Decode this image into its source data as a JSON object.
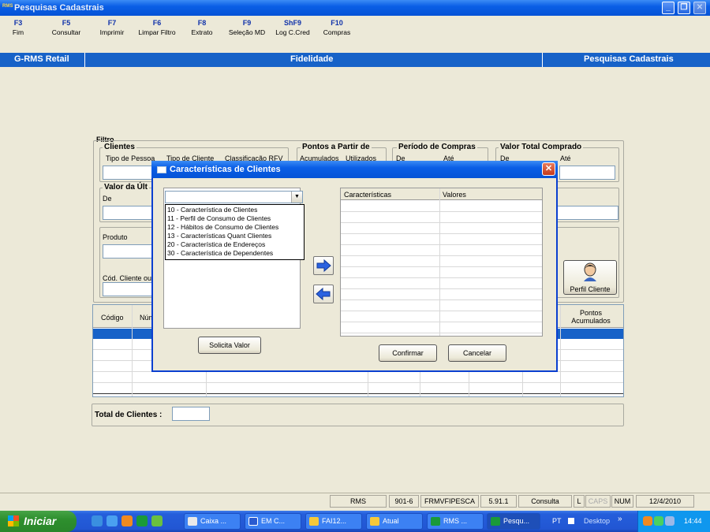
{
  "window": {
    "app_badge": "RMS",
    "title": "Pesquisas Cadastrais"
  },
  "fkeys": [
    {
      "key": "F3",
      "label": "Fim"
    },
    {
      "key": "F5",
      "label": "Consultar"
    },
    {
      "key": "F7",
      "label": "Imprimir"
    },
    {
      "key": "F6",
      "label": "Limpar Filtro"
    },
    {
      "key": "F8",
      "label": "Extrato"
    },
    {
      "key": "F9",
      "label": "Seleção MD"
    },
    {
      "key": "ShF9",
      "label": "Log C.Cred"
    },
    {
      "key": "F10",
      "label": "Compras"
    }
  ],
  "modbar": {
    "left": "G-RMS Retail",
    "center": "Fidelidade",
    "right": "Pesquisas Cadastrais"
  },
  "filtro": {
    "title": "Filtro",
    "clientes": "Clientes",
    "tipo_pessoa": "Tipo de Pessoa",
    "tipo_cliente": "Tipo de Cliente",
    "classificacao": "Classificação RFV",
    "pontos": "Pontos a Partir de",
    "acumulados": "Acumulados",
    "utilizados": "Utilizados",
    "periodo": "Período de Compras",
    "periodo_de": "De",
    "periodo_ate": "Até",
    "valor_total": "Valor Total Comprado",
    "vt_de": "De",
    "vt_ate": "Até",
    "valor_ultima": "Valor da Últ",
    "vu_de": "De",
    "produto": "Produto",
    "cod_cliente": "Cód. Cliente ou",
    "perfil_cliente": "Perfil Cliente"
  },
  "grid": {
    "col_codigo": "Código",
    "col_num": "Núm",
    "col_pontos": "Pontos Acumulados"
  },
  "total": {
    "label": "Total de Clientes :",
    "value": ""
  },
  "dialog": {
    "title": "Características de Clientes",
    "combo_value": "",
    "options": [
      "10 - Característica de Clientes",
      "11 - Perfil de Consumo de Clientes",
      "12 - Hábitos de Consumo de Clientes",
      "13 - Características Quant Clientes",
      "20 - Característica de Endereços",
      "30 - Característica de Dependentes"
    ],
    "col_caracteristicas": "Características",
    "col_valores": "Valores",
    "solicita": "Solicita Valor",
    "confirmar": "Confirmar",
    "cancelar": "Cancelar"
  },
  "status": {
    "s1": "RMS",
    "s2": "901-6",
    "s3": "FRMVFIPESCA",
    "s4": "5.91.1",
    "s5": "Consulta",
    "s6": "L",
    "s7": "CAPS",
    "s8": "NUM",
    "s9": "12/4/2010"
  },
  "taskbar": {
    "start": "Iniciar",
    "tasks": [
      "Caixa ...",
      "EM C...",
      "FAI12...",
      "Atual",
      "RMS ...",
      "Pesqu..."
    ],
    "lang": "PT",
    "desktop": "Desktop",
    "time": "14:44"
  },
  "colors": {
    "titlebar": "#0a5ee6",
    "modbar": "#1762c8",
    "taskbar": "#245edb",
    "start": "#2e8f2e",
    "fkey_blue": "#1133aa"
  }
}
